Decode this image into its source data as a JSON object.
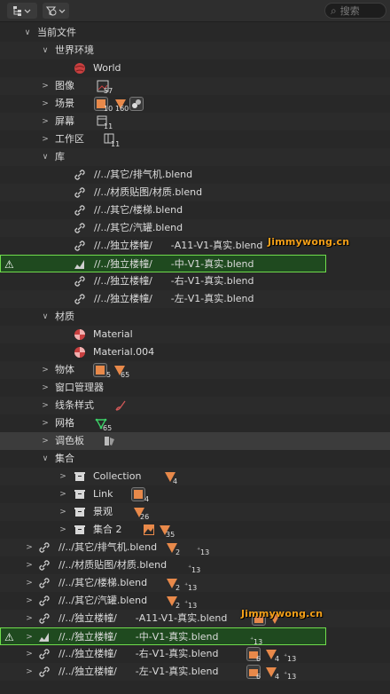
{
  "header": {
    "search_placeholder": "搜索"
  },
  "tree": {
    "root_label": "当前文件",
    "world_env_label": "世界环境",
    "world_label": "World",
    "images_label": "图像",
    "images_count": "57",
    "scenes_label": "场景",
    "scenes_count_a": "10",
    "scenes_count_b": "160",
    "screens_label": "屏幕",
    "screens_count": "11",
    "workspaces_label": "工作区",
    "workspaces_count": "11",
    "library_label": "库",
    "lib_items": [
      "//../其它/排气机.blend",
      "//../材质贴图/材质.blend",
      "//../其它/楼梯.blend",
      "//../其它/汽罐.blend",
      "//../独立楼幢/      -A11-V1-真实.blend",
      "//../独立楼幢/      -中-V1-真实.blend",
      "//../独立楼幢/      -右-V1-真实.blend",
      "//../独立楼幢/      -左-V1-真实.blend"
    ],
    "materials_label": "材质",
    "material_items": [
      "Material",
      "Material.004"
    ],
    "objects_label": "物体",
    "objects_count_a": "5",
    "objects_count_b": "65",
    "wm_label": "窗口管理器",
    "linestyle_label": "线条样式",
    "mesh_label": "网格",
    "mesh_count": "65",
    "palette_label": "调色板",
    "collection_label": "集合",
    "collection_items": [
      {
        "label": "Collection",
        "count": "4"
      },
      {
        "label": "Link",
        "count": "4"
      },
      {
        "label": "景观",
        "count": "26"
      },
      {
        "label": "集合 2",
        "count": "35"
      }
    ],
    "linked_files": [
      {
        "label": "//../其它/排气机.blend",
        "c1": "2",
        "c2": "13"
      },
      {
        "label": "//../材质贴图/材质.blend",
        "c1": "",
        "c2": "13"
      },
      {
        "label": "//../其它/楼梯.blend",
        "c1": "2",
        "c2": "13"
      },
      {
        "label": "//../其它/汽罐.blend",
        "c1": "2",
        "c2": "13"
      },
      {
        "label": "//../独立楼幢/      -A11-V1-真实.blend",
        "c1": "",
        "c2": "13"
      },
      {
        "label": "//../独立楼幢/      -中-V1-真实.blend",
        "c1": "",
        "c2": "13"
      },
      {
        "label": "//../独立楼幢/      -右-V1-真实.blend",
        "c1": "6",
        "c2": "4",
        "c3": "13"
      },
      {
        "label": "//../独立楼幢/      -左-V1-真实.blend",
        "c1": "6",
        "c2": "4",
        "c3": "13"
      }
    ]
  },
  "watermark": "Jimmywong.cn",
  "colors": {
    "warning_outline": "#6fdc4c",
    "warning_fill": "#1f4a1f",
    "watermark": "#f4a018",
    "object_icon": "#e8894a"
  }
}
